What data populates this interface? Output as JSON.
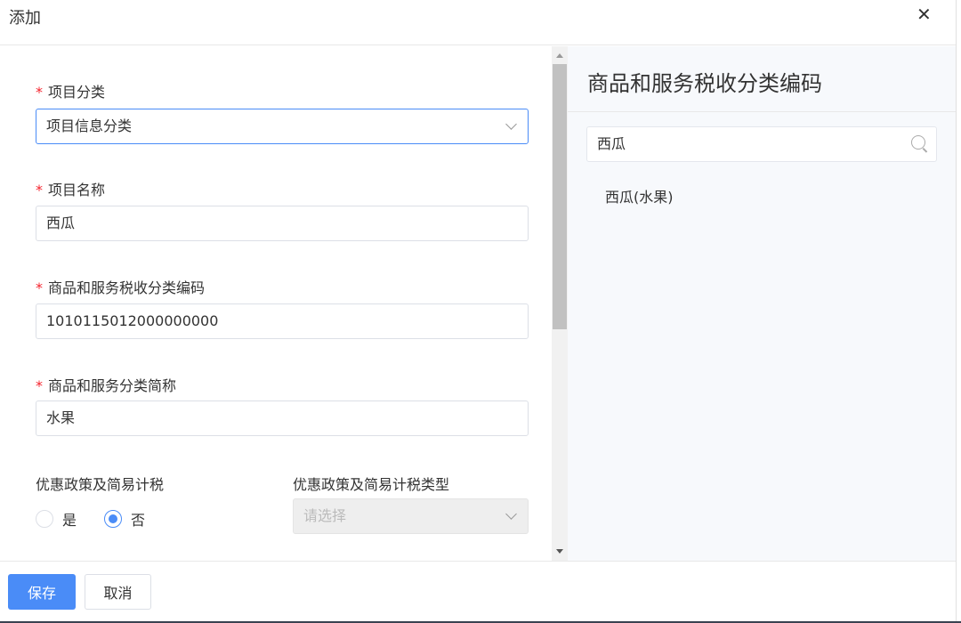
{
  "dialog": {
    "title": "添加",
    "close_icon": "close-icon"
  },
  "form": {
    "required_mark": "*",
    "category": {
      "label": "项目分类",
      "value": "项目信息分类"
    },
    "name": {
      "label": "项目名称",
      "value": "西瓜"
    },
    "tax_code": {
      "label": "商品和服务税收分类编码",
      "value": "1010115012000000000"
    },
    "short_name": {
      "label": "商品和服务分类简称",
      "value": "水果"
    },
    "preferential": {
      "label": "优惠政策及简易计税",
      "options": [
        "是",
        "否"
      ],
      "selected": "否"
    },
    "preferential_type": {
      "label": "优惠政策及简易计税类型",
      "placeholder": "请选择",
      "disabled": true
    }
  },
  "panel": {
    "title": "商品和服务税收分类编码",
    "search_value": "西瓜",
    "results": [
      "西瓜(水果)"
    ]
  },
  "footer": {
    "save": "保存",
    "cancel": "取消"
  },
  "colors": {
    "primary": "#4a8cf7",
    "required": "#f5222d",
    "panel_bg": "#f7f9fc"
  }
}
